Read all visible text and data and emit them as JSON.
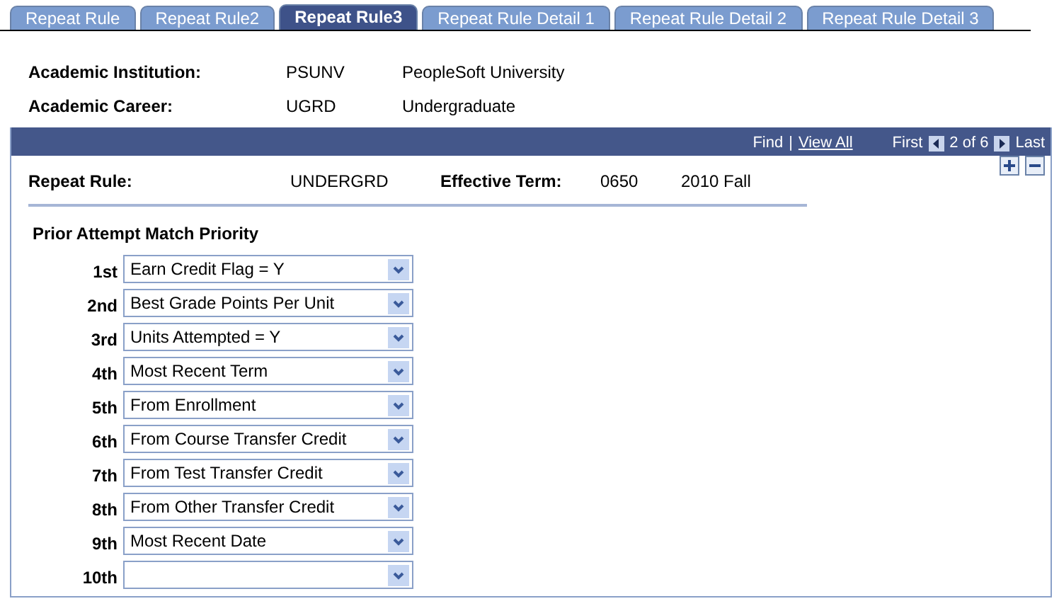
{
  "tabs": [
    {
      "label": "Repeat Rule",
      "selected": false
    },
    {
      "label": "Repeat Rule2",
      "selected": false
    },
    {
      "label": "Repeat Rule3",
      "selected": true
    },
    {
      "label": "Repeat Rule Detail 1",
      "selected": false
    },
    {
      "label": "Repeat Rule Detail 2",
      "selected": false
    },
    {
      "label": "Repeat Rule Detail 3",
      "selected": false
    }
  ],
  "header_fields": [
    {
      "label": "Academic Institution:",
      "code": "PSUNV",
      "description": "PeopleSoft University"
    },
    {
      "label": "Academic Career:",
      "code": "UGRD",
      "description": "Undergraduate"
    }
  ],
  "panel": {
    "nav": {
      "find": "Find",
      "separator": "|",
      "view_all": "View All",
      "first": "First",
      "position": "2 of 6",
      "last": "Last"
    },
    "repeat_rule": {
      "label": "Repeat Rule:",
      "value": "UNDERGRD"
    },
    "effective_term": {
      "label": "Effective Term:",
      "code": "0650",
      "description": "2010 Fall"
    },
    "section_title": "Prior Attempt Match Priority",
    "priorities": [
      {
        "label": "1st",
        "value": "Earn Credit Flag = Y"
      },
      {
        "label": "2nd",
        "value": "Best Grade Points Per Unit"
      },
      {
        "label": "3rd",
        "value": "Units Attempted = Y"
      },
      {
        "label": "4th",
        "value": "Most Recent Term"
      },
      {
        "label": "5th",
        "value": "From Enrollment"
      },
      {
        "label": "6th",
        "value": "From Course Transfer Credit"
      },
      {
        "label": "7th",
        "value": "From Test Transfer Credit"
      },
      {
        "label": "8th",
        "value": "From Other Transfer Credit"
      },
      {
        "label": "9th",
        "value": "Most Recent Date"
      },
      {
        "label": "10th"
      }
    ]
  }
}
